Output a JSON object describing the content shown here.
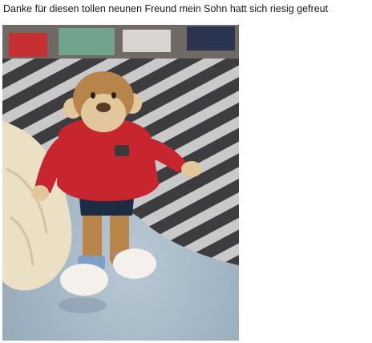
{
  "post": {
    "caption": "Danke für diesen tollen neunen Freund mein Sohn hatt sich riesig gefreut"
  },
  "photo": {
    "subject": "monkey-plush-toy",
    "colors": {
      "hoodie": "#c8262e",
      "fur": "#b7844a",
      "face": "#e3c79c",
      "stripe_dark": "#3d3d40",
      "stripe_light": "#c9c9c9",
      "sheet": "#9fb2c1"
    }
  }
}
